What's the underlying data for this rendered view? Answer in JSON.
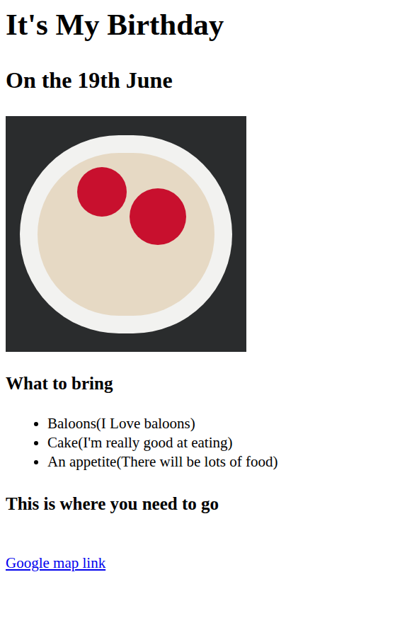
{
  "title": "It's My Birthday",
  "subtitle": "On the 19th June",
  "bring": {
    "heading": "What to bring",
    "items": [
      "Baloons(I Love baloons)",
      "Cake(I'm really good at eating)",
      "An appetite(There will be lots of food)"
    ]
  },
  "location": {
    "heading": "This is where you need to go",
    "link": "Google map link"
  }
}
